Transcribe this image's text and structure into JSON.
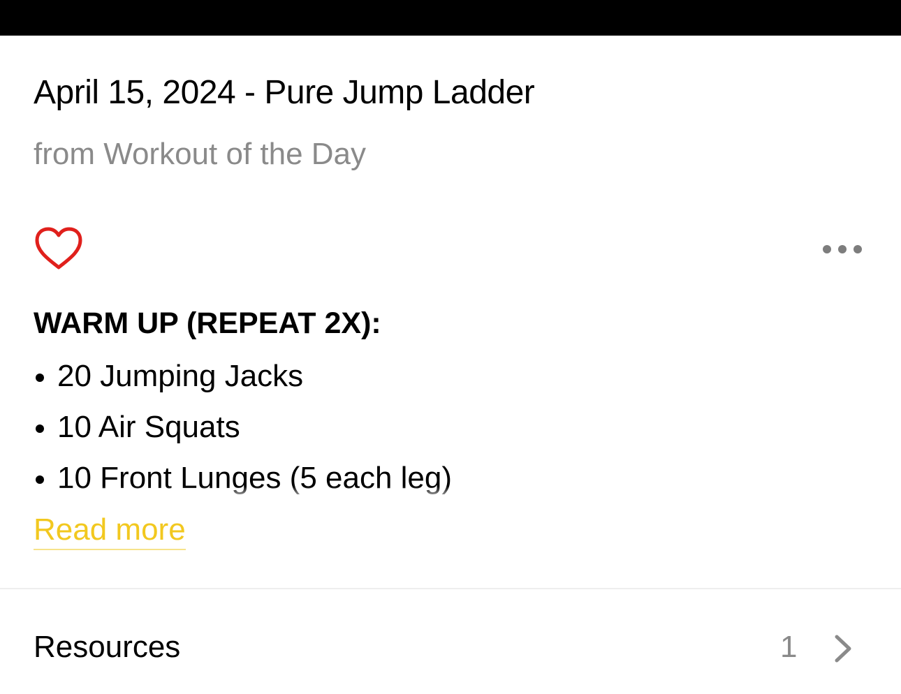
{
  "workout": {
    "title": "April 15, 2024 - Pure Jump Ladder",
    "source": "from Workout of the Day"
  },
  "actions": {
    "favorite_icon": "heart-outline-icon",
    "more_icon": "ellipsis-icon"
  },
  "description": {
    "heading": "WARM UP (REPEAT 2X):",
    "items": [
      "20 Jumping Jacks",
      "10 Air Squats",
      "10 Front Lunges (5 each leg)"
    ],
    "read_more_label": "Read more"
  },
  "resources": {
    "label": "Resources",
    "count": "1",
    "chevron_icon": "chevron-right-icon"
  },
  "colors": {
    "accent": "#f2c81f",
    "heart": "#e0201c",
    "secondary_text": "#8a8a8a"
  }
}
